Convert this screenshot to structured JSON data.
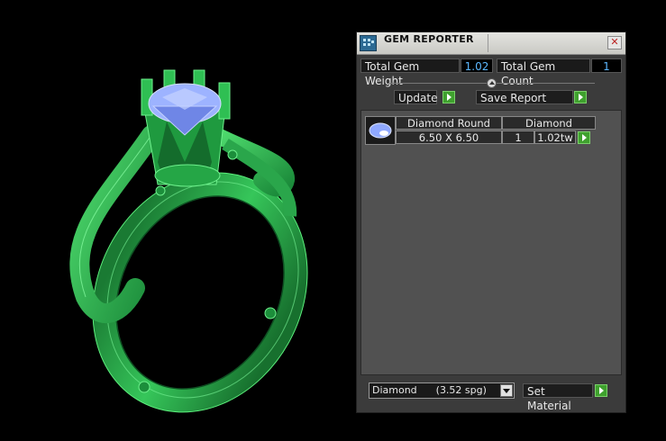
{
  "window": {
    "title": "GEM REPORTER",
    "close_glyph": "✕"
  },
  "summary": {
    "weight_label": "Total Gem Weight",
    "weight_value": "1.02",
    "count_label": "Total Gem Count",
    "count_value": "1"
  },
  "actions": {
    "update_label": "Update",
    "save_label": "Save Report"
  },
  "gems": [
    {
      "shape": "Diamond Round",
      "material": "Diamond",
      "size": "6.50 X 6.50",
      "quantity": "1",
      "weight": "1.02tw"
    }
  ],
  "footer": {
    "material_select": "Diamond      (3.52 spg)",
    "set_material_label": "Set Material"
  },
  "colors": {
    "ring": "#2fbf53",
    "gem": "#8fa8ff",
    "value_text": "#5cb8ff",
    "go_button": "#3fa12e"
  },
  "icons": [
    "app-icon",
    "close-icon",
    "slider-knob-icon",
    "go-arrow-icon",
    "gem-thumbnail-icon",
    "dropdown-arrow-icon"
  ]
}
